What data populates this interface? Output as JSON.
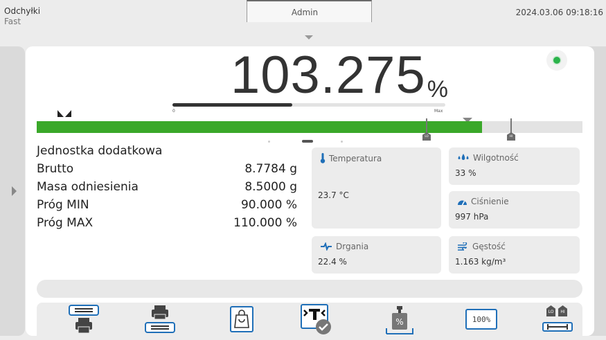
{
  "header": {
    "mode": "Odchyłki",
    "sub_mode": "Fast",
    "user": "Admin",
    "datetime": "2024.03.06 09:18:16"
  },
  "reading": {
    "value": "103.275",
    "unit": "%",
    "stable": true
  },
  "mini_bar": {
    "start_label": "0",
    "end_label": "Max",
    "fill_fraction": 0.44
  },
  "deviation_bar": {
    "fill_fraction": 0.816,
    "lo_label": "LO",
    "hi_label": "HI"
  },
  "info": {
    "header": "Jednostka dodatkowa",
    "rows": [
      {
        "label": "Brutto",
        "value": "8.7784 g"
      },
      {
        "label": "Masa odniesienia",
        "value": "8.5000 g"
      },
      {
        "label": "Próg MIN",
        "value": "90.000 %"
      },
      {
        "label": "Próg MAX",
        "value": "110.000 %"
      }
    ]
  },
  "sensors": {
    "temperature": {
      "label": "Temperatura",
      "value": "23.7 °C"
    },
    "humidity": {
      "label": "Wilgotność",
      "value": "33 %"
    },
    "pressure": {
      "label": "Ciśnienie",
      "value": "997 hPa"
    },
    "vibration": {
      "label": "Drgania",
      "value": "22.4 %"
    },
    "density": {
      "label": "Gęstość",
      "value": "1.163 kg/m³"
    }
  },
  "toolbar": {
    "percent_label": "100%",
    "lo_label": "LO",
    "hi_label": "HI"
  },
  "colors": {
    "accent": "#1f6fb8",
    "bar_fill": "#3aa829",
    "stable": "#2ab34a"
  }
}
